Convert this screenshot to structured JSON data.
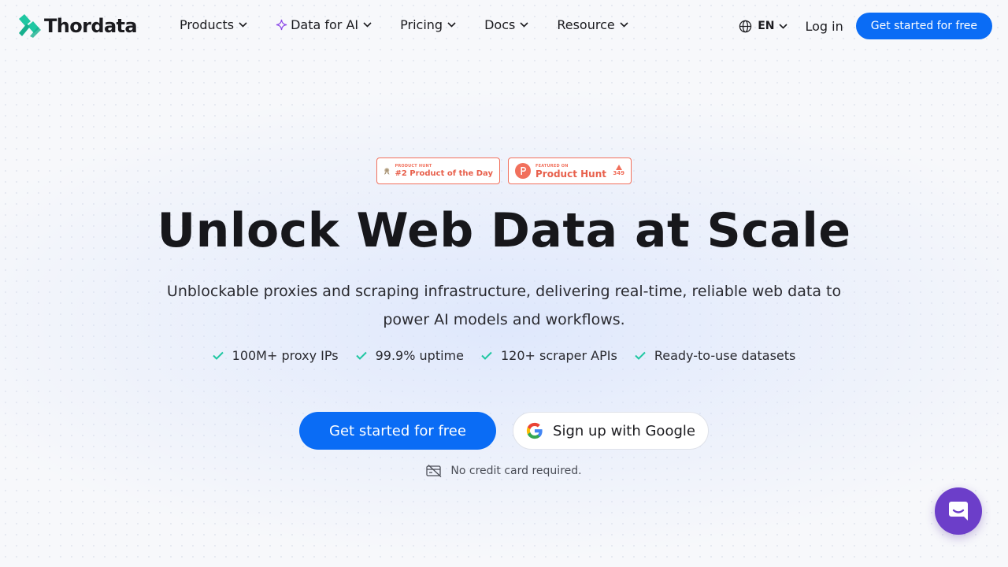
{
  "brand": {
    "name": "Thordata",
    "accent": "#0a6cf5",
    "logo_color": "#1fc7a2"
  },
  "nav": {
    "items": [
      {
        "label": "Products",
        "icon": "chevron-down-icon"
      },
      {
        "label": "Data for AI",
        "icon": "chevron-down-icon",
        "prefix_icon": "sparkle-icon"
      },
      {
        "label": "Pricing",
        "icon": "chevron-down-icon"
      },
      {
        "label": "Docs",
        "icon": "chevron-down-icon"
      },
      {
        "label": "Resource",
        "icon": "chevron-down-icon"
      }
    ],
    "language": "EN",
    "login": "Log in",
    "cta": "Get started for free"
  },
  "badges": {
    "product_of_day": {
      "small": "PRODUCT HUNT",
      "main": "#2 Product of the Day"
    },
    "featured": {
      "small": "FEATURED ON",
      "main": "Product Hunt",
      "votes": "349"
    }
  },
  "hero": {
    "title": "Unlock Web Data at Scale",
    "subtitle": "Unblockable proxies and scraping infrastructure, delivering real-time, reliable web data to power AI models and workflows.",
    "features": [
      "100M+ proxy IPs",
      "99.9% uptime",
      "120+ scraper APIs",
      "Ready-to-use datasets"
    ],
    "primary_cta": "Get started for free",
    "google_cta": "Sign up with Google",
    "note": "No credit card required."
  },
  "chat": {
    "icon": "chat-bubble-icon",
    "color": "#6c3ec9"
  }
}
